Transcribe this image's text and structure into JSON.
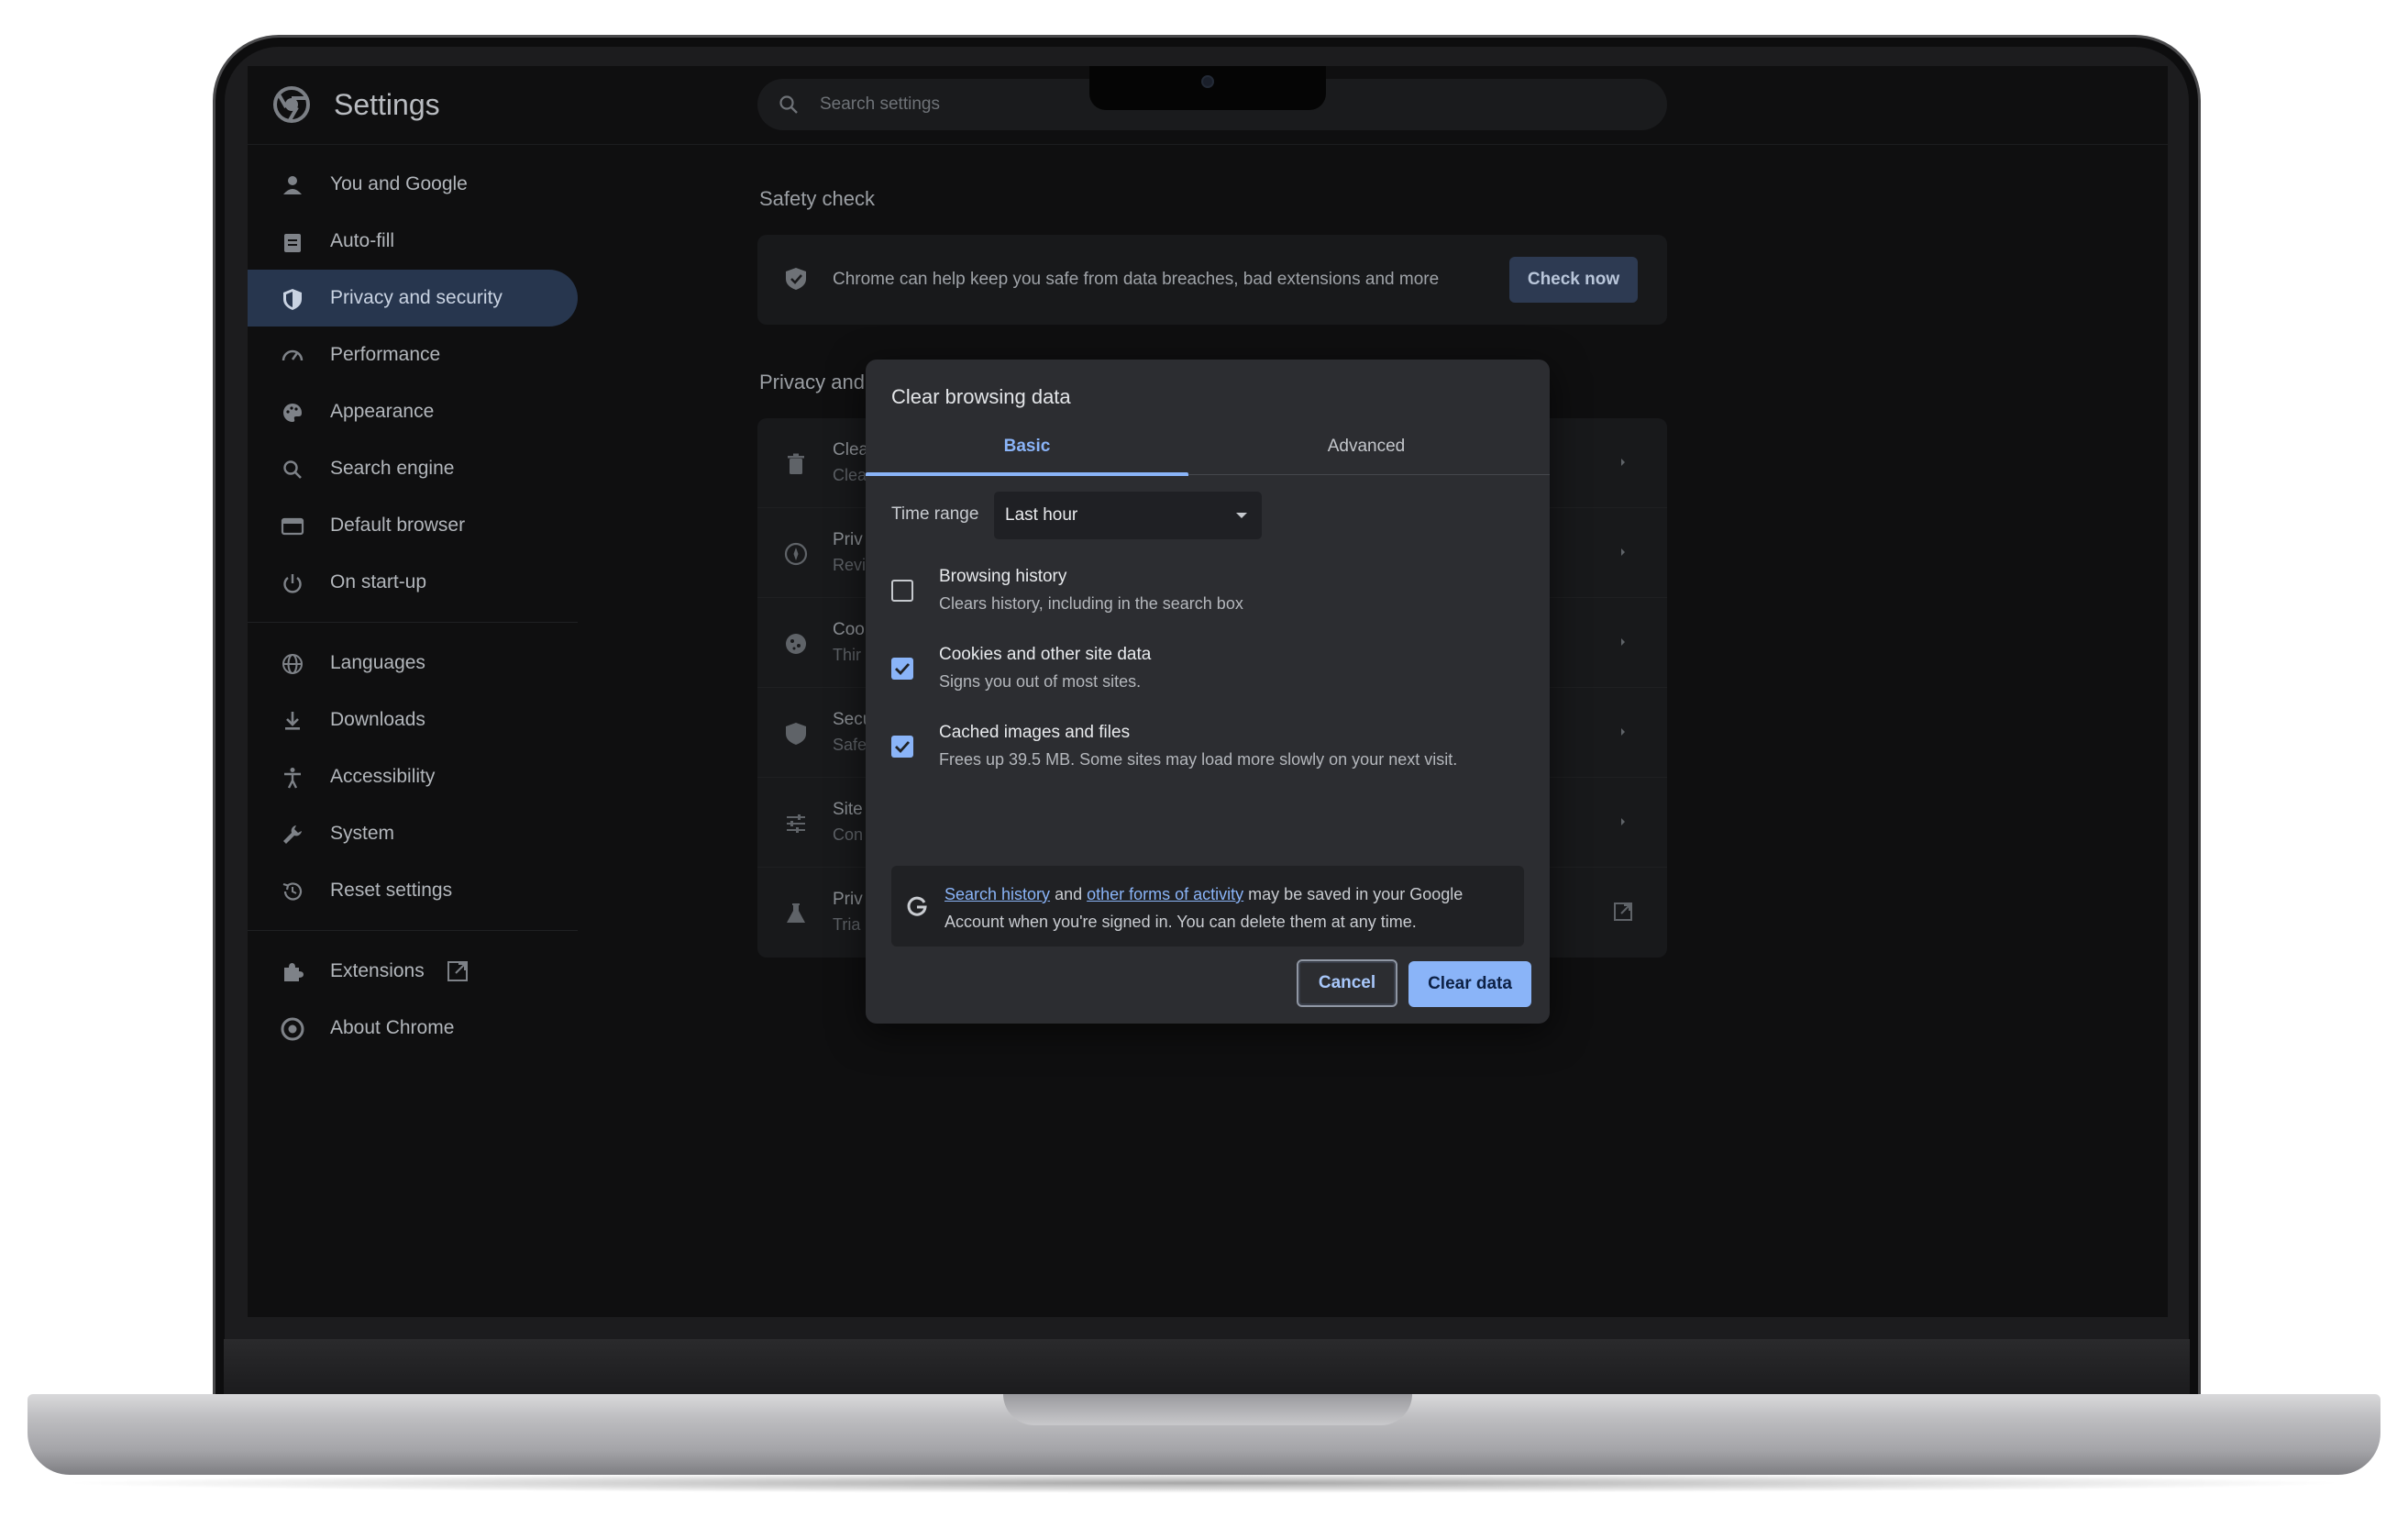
{
  "app": {
    "title": "Settings"
  },
  "search": {
    "placeholder": "Search settings"
  },
  "sidebar": {
    "items": [
      {
        "label": "You and Google",
        "icon": "person-icon"
      },
      {
        "label": "Auto-fill",
        "icon": "clipboard-icon"
      },
      {
        "label": "Privacy and security",
        "icon": "shield-icon",
        "active": true
      },
      {
        "label": "Performance",
        "icon": "speedometer-icon"
      },
      {
        "label": "Appearance",
        "icon": "palette-icon"
      },
      {
        "label": "Search engine",
        "icon": "search-icon"
      },
      {
        "label": "Default browser",
        "icon": "browser-icon"
      },
      {
        "label": "On start-up",
        "icon": "power-icon"
      },
      {
        "label": "Languages",
        "icon": "globe-icon"
      },
      {
        "label": "Downloads",
        "icon": "download-icon"
      },
      {
        "label": "Accessibility",
        "icon": "accessibility-icon"
      },
      {
        "label": "System",
        "icon": "wrench-icon"
      },
      {
        "label": "Reset settings",
        "icon": "restore-icon"
      },
      {
        "label": "Extensions",
        "icon": "puzzle-icon"
      },
      {
        "label": "About Chrome",
        "icon": "chrome-icon"
      }
    ]
  },
  "main": {
    "safety_check": {
      "title": "Safety check",
      "text": "Chrome can help keep you safe from data breaches, bad extensions and more",
      "button": "Check now"
    },
    "privacy": {
      "title": "Privacy and",
      "rows": [
        {
          "title": "Clea",
          "sub": "Clea"
        },
        {
          "title": "Priv",
          "sub": "Revi"
        },
        {
          "title": "Coo",
          "sub": "Thir"
        },
        {
          "title": "Secu",
          "sub": "Safe"
        },
        {
          "title": "Site",
          "sub": "Con"
        },
        {
          "title": "Priv",
          "sub": "Tria"
        }
      ]
    }
  },
  "dialog": {
    "title": "Clear browsing data",
    "tabs": [
      "Basic",
      "Advanced"
    ],
    "active_tab": "Basic",
    "time_range": {
      "label": "Time range",
      "value": "Last hour"
    },
    "options": [
      {
        "title": "Browsing history",
        "sub": "Clears history, including in the search box",
        "checked": false
      },
      {
        "title": "Cookies and other site data",
        "sub": "Signs you out of most sites.",
        "checked": true
      },
      {
        "title": "Cached images and files",
        "sub": "Frees up 39.5 MB. Some sites may load more slowly on your next visit.",
        "checked": true
      }
    ],
    "info": {
      "link1": "Search history",
      "mid1": " and ",
      "link2": "other forms of activity",
      "rest": " may be saved in your Google Account when you're signed in. You can delete them at any time."
    },
    "cancel": "Cancel",
    "confirm": "Clear data"
  },
  "colors": {
    "accent": "#8ab4f8",
    "dialog_bg": "#2c2d31",
    "active_nav": "#27364e"
  }
}
